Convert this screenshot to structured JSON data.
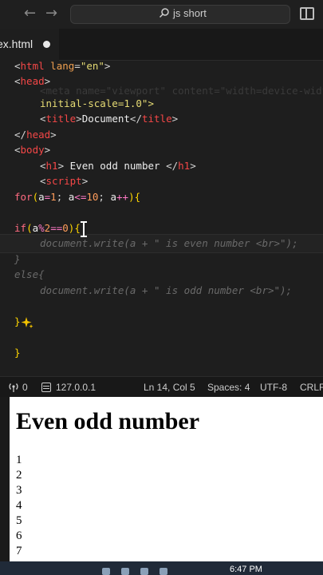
{
  "titlebar": {
    "back_icon": "arrow-left-icon",
    "forward_icon": "arrow-right-icon",
    "search_text": "js short",
    "layout_icon": "sidebar-layout-icon"
  },
  "tabs": {
    "active_tab": "ex.html",
    "unsaved_indicator": "dot-icon"
  },
  "editor": {
    "lines": {
      "l1": [
        "<",
        "html",
        " lang",
        "=",
        "\"en\"",
        ">"
      ],
      "l2": [
        "<",
        "head",
        ">"
      ],
      "l3_partial": "<meta name=\"viewport\" content=\"width=device-width,",
      "l4": [
        "initial-scale=1.0\">"
      ],
      "l5": [
        "<",
        "title",
        ">",
        "Document",
        "</",
        "title",
        ">"
      ],
      "l6": [
        "</",
        "head",
        ">"
      ],
      "l7": [
        "<",
        "body",
        ">"
      ],
      "l8": [
        "<",
        "h1",
        ">",
        " Even odd number ",
        "</",
        "h1",
        ">"
      ],
      "l9": [
        "<",
        "script",
        ">"
      ],
      "l10": [
        "for",
        "(",
        "a",
        "=",
        "1",
        "; ",
        "a",
        "<=",
        "10",
        "; ",
        "a",
        "++",
        ")",
        "{"
      ],
      "l11": [
        "if",
        "(",
        "a",
        "%",
        "2",
        "==",
        "0",
        ")",
        "{"
      ],
      "l12": "document.write(a + \" is even number <br>\");",
      "l13": "}",
      "l14": "else{",
      "l15": "document.write(a + \" is odd number <br>\");",
      "l16": "}",
      "l17": "}"
    }
  },
  "statusbar": {
    "ports": "0",
    "server": "127.0.0.1",
    "cursor_pos": "Ln 14, Col 5",
    "spaces": "Spaces: 4",
    "encoding": "UTF-8",
    "eol": "CRLF"
  },
  "preview": {
    "heading": "Even odd number",
    "numbers": [
      "1",
      "2",
      "3",
      "4",
      "5",
      "6",
      "7"
    ]
  },
  "taskbar": {
    "time": "6:47 PM"
  },
  "colors": {
    "editor_bg": "#1e1e1e",
    "tag": "#f44747",
    "string": "#e6db74",
    "keyword": "#ff6b81",
    "number": "#ff9d5c"
  }
}
